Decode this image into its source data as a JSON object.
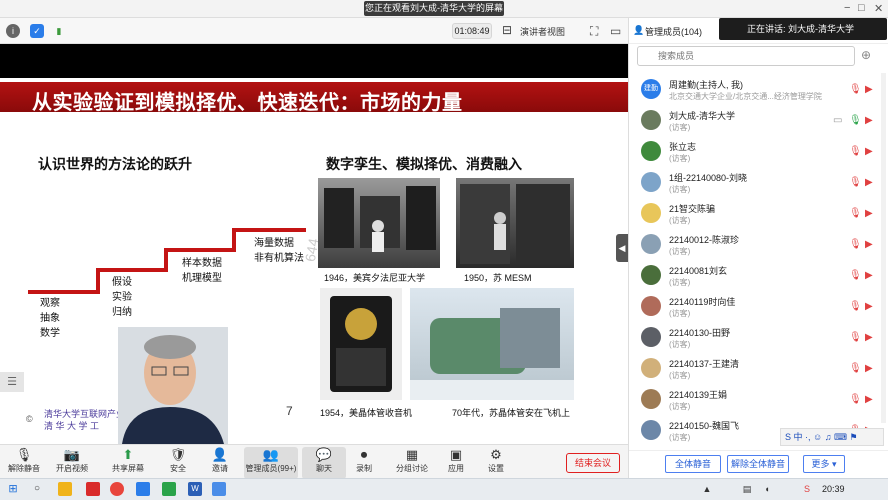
{
  "window": {
    "title": "您正在观看刘大成-清华大学的屏幕",
    "controls": [
      "−",
      "□",
      "✕"
    ]
  },
  "toolbar": {
    "timer": "01:08:49",
    "view_label": "演讲者视图",
    "members_header": "管理成员(104)"
  },
  "slide": {
    "title": "从实验验证到模拟择优、快速迭代：市场的力量",
    "left_subtitle": "认识世界的方法论的跃升",
    "right_subtitle": "数字孪生、模拟择优、消费融入",
    "steps": [
      {
        "lines": [
          "观察",
          "抽象",
          "数学"
        ]
      },
      {
        "lines": [
          "假设",
          "实验",
          "归纳"
        ]
      },
      {
        "lines": [
          "样本数据",
          "机理模型"
        ]
      },
      {
        "lines": [
          "海量数据",
          "非有机算法"
        ]
      }
    ],
    "captions": {
      "eniac": "1946，美宾夕法尼亚大学",
      "mesm": "1950，苏 MESM",
      "radio": "1954，美晶体管收音机",
      "jet": "70年代，苏晶体管安在飞机上"
    },
    "footer_line1": "清华大学互联网产业",
    "footer_line2": "清 华 大 学 工",
    "copyright": "©",
    "page_number": "7",
    "watermark": "644"
  },
  "bottombar": {
    "items": [
      {
        "label": "解除静音",
        "icon": "🎙"
      },
      {
        "label": "开启视频",
        "icon": "📷"
      },
      {
        "label": "共享屏幕",
        "icon": "⬆"
      },
      {
        "label": "安全",
        "icon": "🛡"
      },
      {
        "label": "邀请",
        "icon": "👤"
      },
      {
        "label": "管理成员(99+)",
        "icon": "👥"
      },
      {
        "label": "聊天",
        "icon": "💬"
      },
      {
        "label": "录制",
        "icon": "⏺"
      },
      {
        "label": "分组讨论",
        "icon": "▦"
      },
      {
        "label": "应用",
        "icon": "▣"
      },
      {
        "label": "设置",
        "icon": "⚙"
      }
    ],
    "end_label": "结束会议"
  },
  "panel": {
    "speaking": "正在讲话: 刘大成-清华大学",
    "search_placeholder": "搜索成员",
    "members": [
      {
        "name": "周建勤(主持人, 我)",
        "role": "北京交通大学企业/北京交通...经济管理学院",
        "color": "#2b7de9",
        "avatar_text": "建勤"
      },
      {
        "name": "刘大成-清华大学",
        "role": "(访客)",
        "color": "#6a7b5e",
        "avatar_text": ""
      },
      {
        "name": "张立志",
        "role": "(访客)",
        "color": "#3f8a3c",
        "avatar_text": ""
      },
      {
        "name": "1组-22140080-刘晓",
        "role": "(访客)",
        "color": "#7da4c9",
        "avatar_text": ""
      },
      {
        "name": "21智交陈骗",
        "role": "(访客)",
        "color": "#e8c65a",
        "avatar_text": ""
      },
      {
        "name": "22140012-陈淑珍",
        "role": "(访客)",
        "color": "#8aa0b4",
        "avatar_text": ""
      },
      {
        "name": "22140081刘玄",
        "role": "(访客)",
        "color": "#4a6e3b",
        "avatar_text": ""
      },
      {
        "name": "22140119时向佳",
        "role": "(访客)",
        "color": "#b06b5a",
        "avatar_text": ""
      },
      {
        "name": "22140130-田野",
        "role": "(访客)",
        "color": "#5c5f66",
        "avatar_text": ""
      },
      {
        "name": "22140137-王建清",
        "role": "(访客)",
        "color": "#d1b07a",
        "avatar_text": ""
      },
      {
        "name": "22140139王娟",
        "role": "(访客)",
        "color": "#9d7b55",
        "avatar_text": ""
      },
      {
        "name": "22140150-魏国飞",
        "role": "(访客)",
        "color": "#6c87a8",
        "avatar_text": ""
      }
    ],
    "mute_all": "全体静音",
    "unmute_all": "解除全体静音",
    "more": "更多 ▾"
  },
  "ime": {
    "text": "S 中 ·, ☺ ♫ ⌨ ⚑"
  },
  "taskbar": {
    "time": "20:39"
  }
}
